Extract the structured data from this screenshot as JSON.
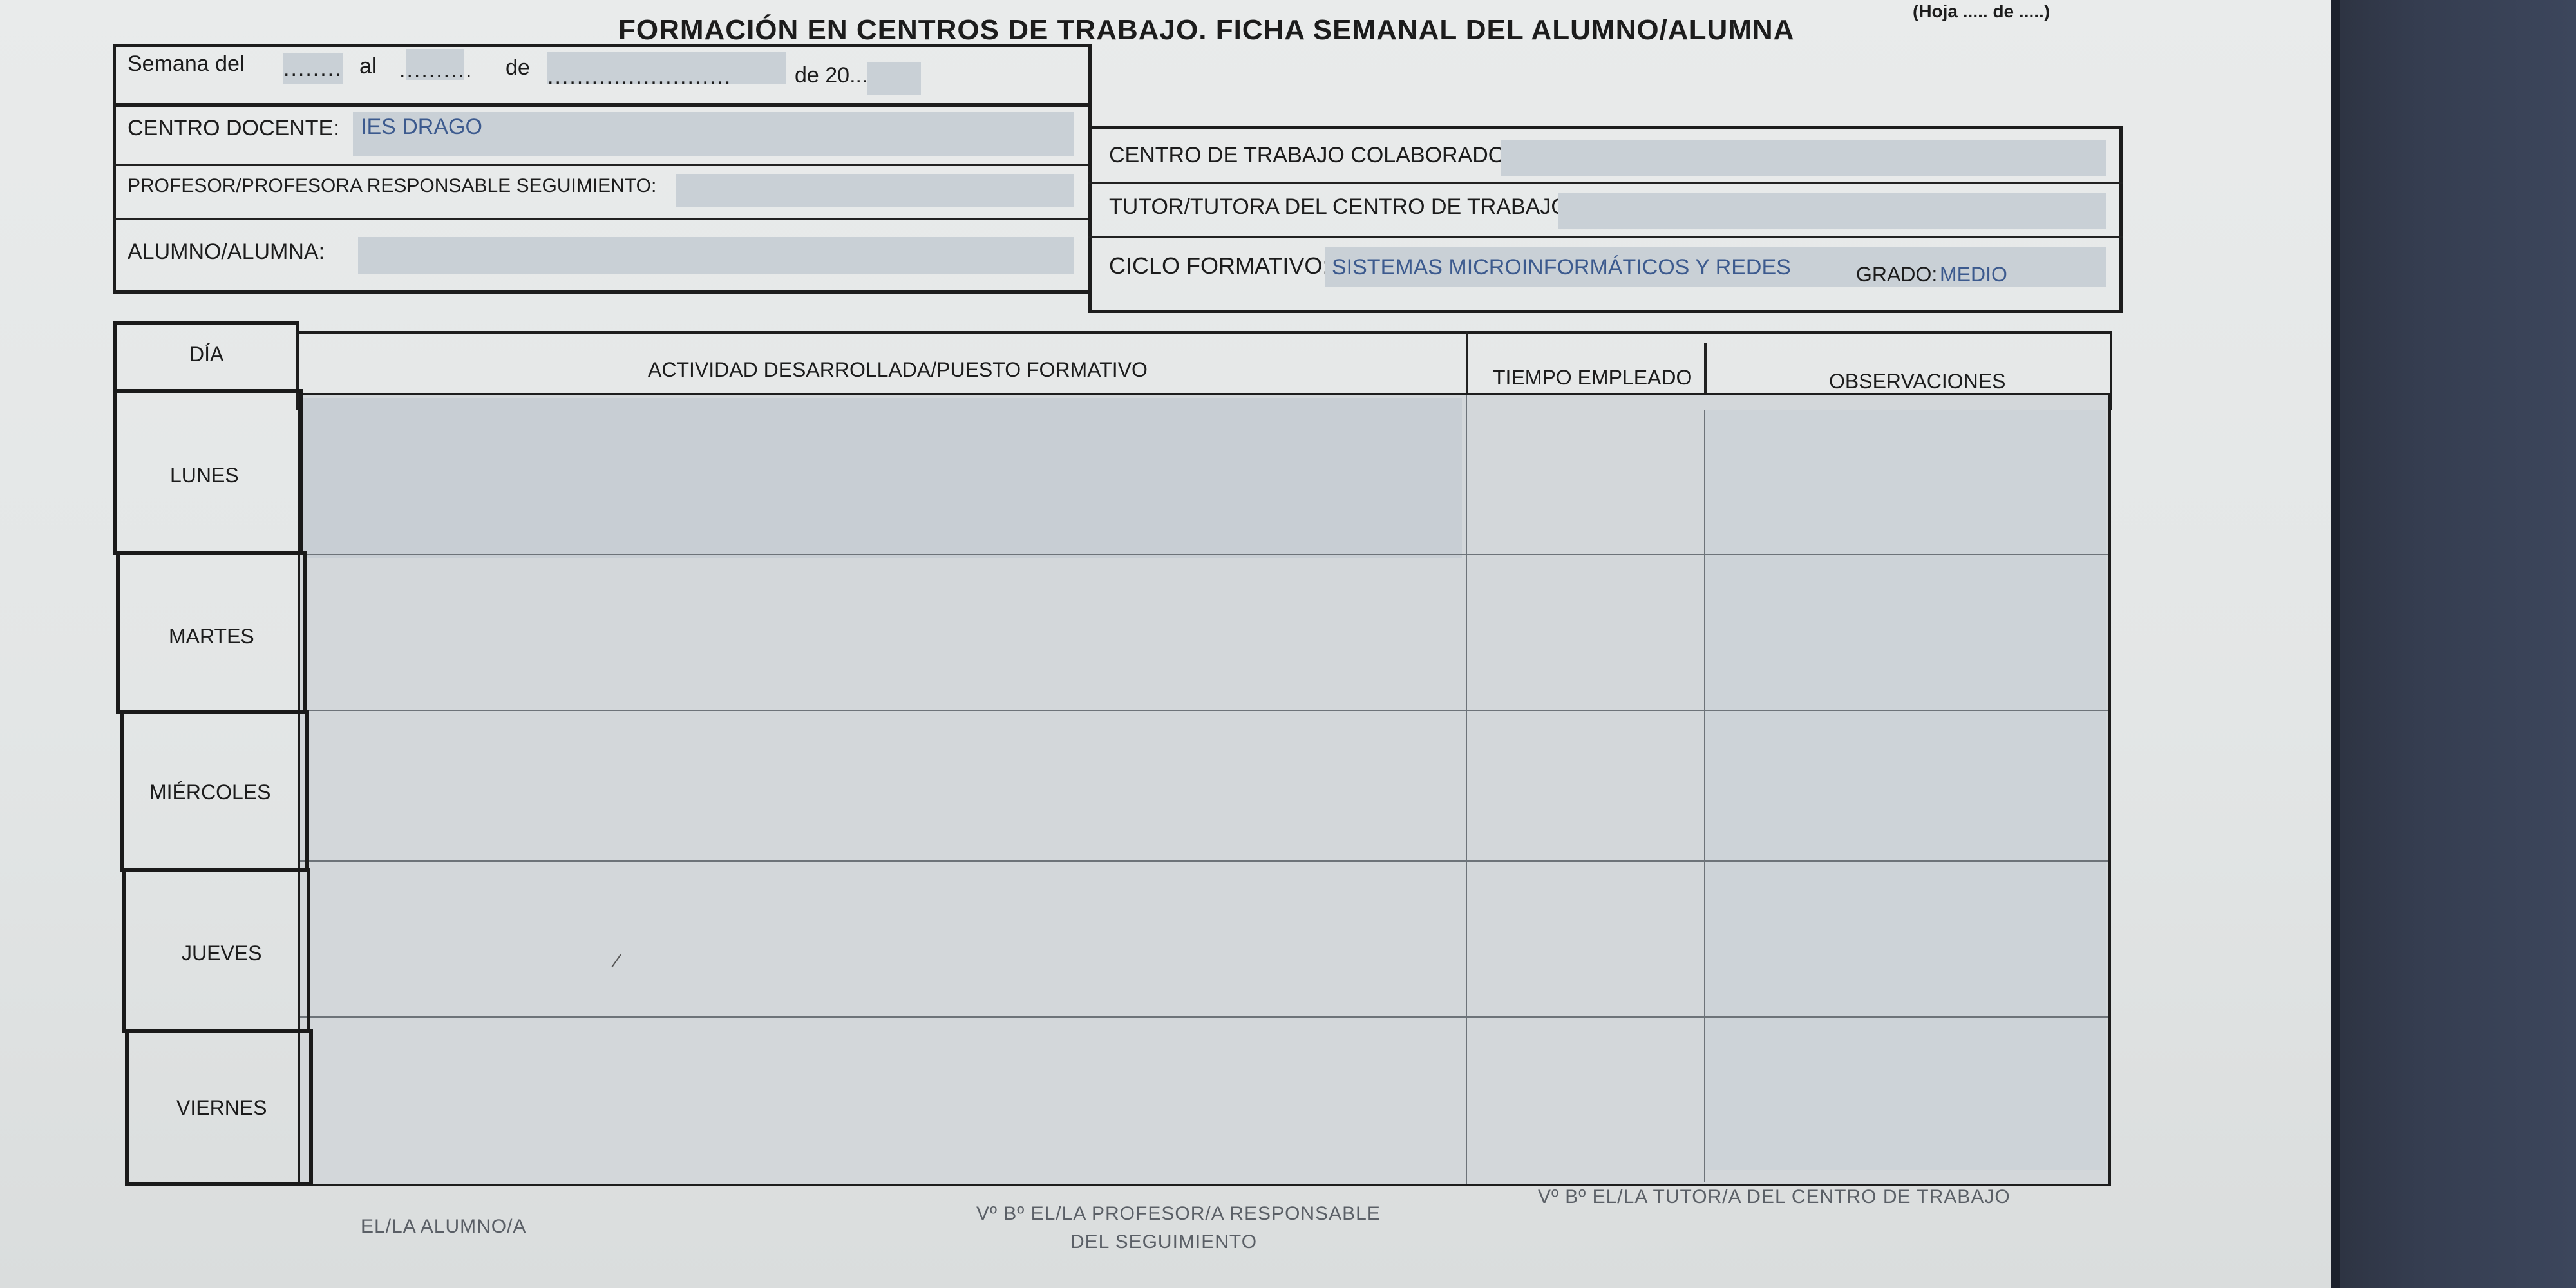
{
  "header": {
    "title": "FORMACIÓN EN CENTROS DE TRABAJO. FICHA SEMANAL DEL ALUMNO/ALUMNA",
    "sheet_counter": "(Hoja ..... de .....)"
  },
  "week": {
    "label_semana": "Semana del",
    "blank_1": "........",
    "label_al": "al",
    "blank_2": "..........",
    "label_de": "de",
    "blank_3": ".........................",
    "label_year": "de 20......"
  },
  "school": {
    "centro_docente_label": "CENTRO DOCENTE:",
    "centro_docente_value": "IES DRAGO",
    "profesor_label": "PROFESOR/PROFESORA RESPONSABLE SEGUIMIENTO:",
    "alumno_label": "ALUMNO/ALUMNA:"
  },
  "company": {
    "centro_trabajo_label": "CENTRO DE TRABAJO COLABORADOR:",
    "tutor_label": "TUTOR/TUTORA DEL CENTRO DE TRABAJO:",
    "ciclo_label": "CICLO FORMATIVO:",
    "ciclo_value": "SISTEMAS MICROINFORMÁTICOS Y REDES",
    "grado_label": "GRADO:",
    "grado_value": "MEDIO"
  },
  "table": {
    "headers": {
      "dia": "DÍA",
      "actividad": "ACTIVIDAD DESARROLLADA/PUESTO FORMATIVO",
      "tiempo": "TIEMPO EMPLEADO",
      "observaciones": "OBSERVACIONES"
    },
    "days": [
      "LUNES",
      "MARTES",
      "MIÉRCOLES",
      "JUEVES",
      "VIERNES"
    ]
  },
  "signatures": {
    "alumno": "EL/LA ALUMNO/A",
    "profesor_line1": "Vº Bº EL/LA PROFESOR/A  RESPONSABLE",
    "profesor_line2": "DEL SEGUIMIENTO",
    "tutor": "Vº Bº EL/LA TUTOR/A DEL CENTRO DE TRABAJO"
  },
  "colors": {
    "field_fill": "#c9d0d6",
    "typed_value": "#3c5a8e",
    "monitor_bezel": "#353d50"
  }
}
